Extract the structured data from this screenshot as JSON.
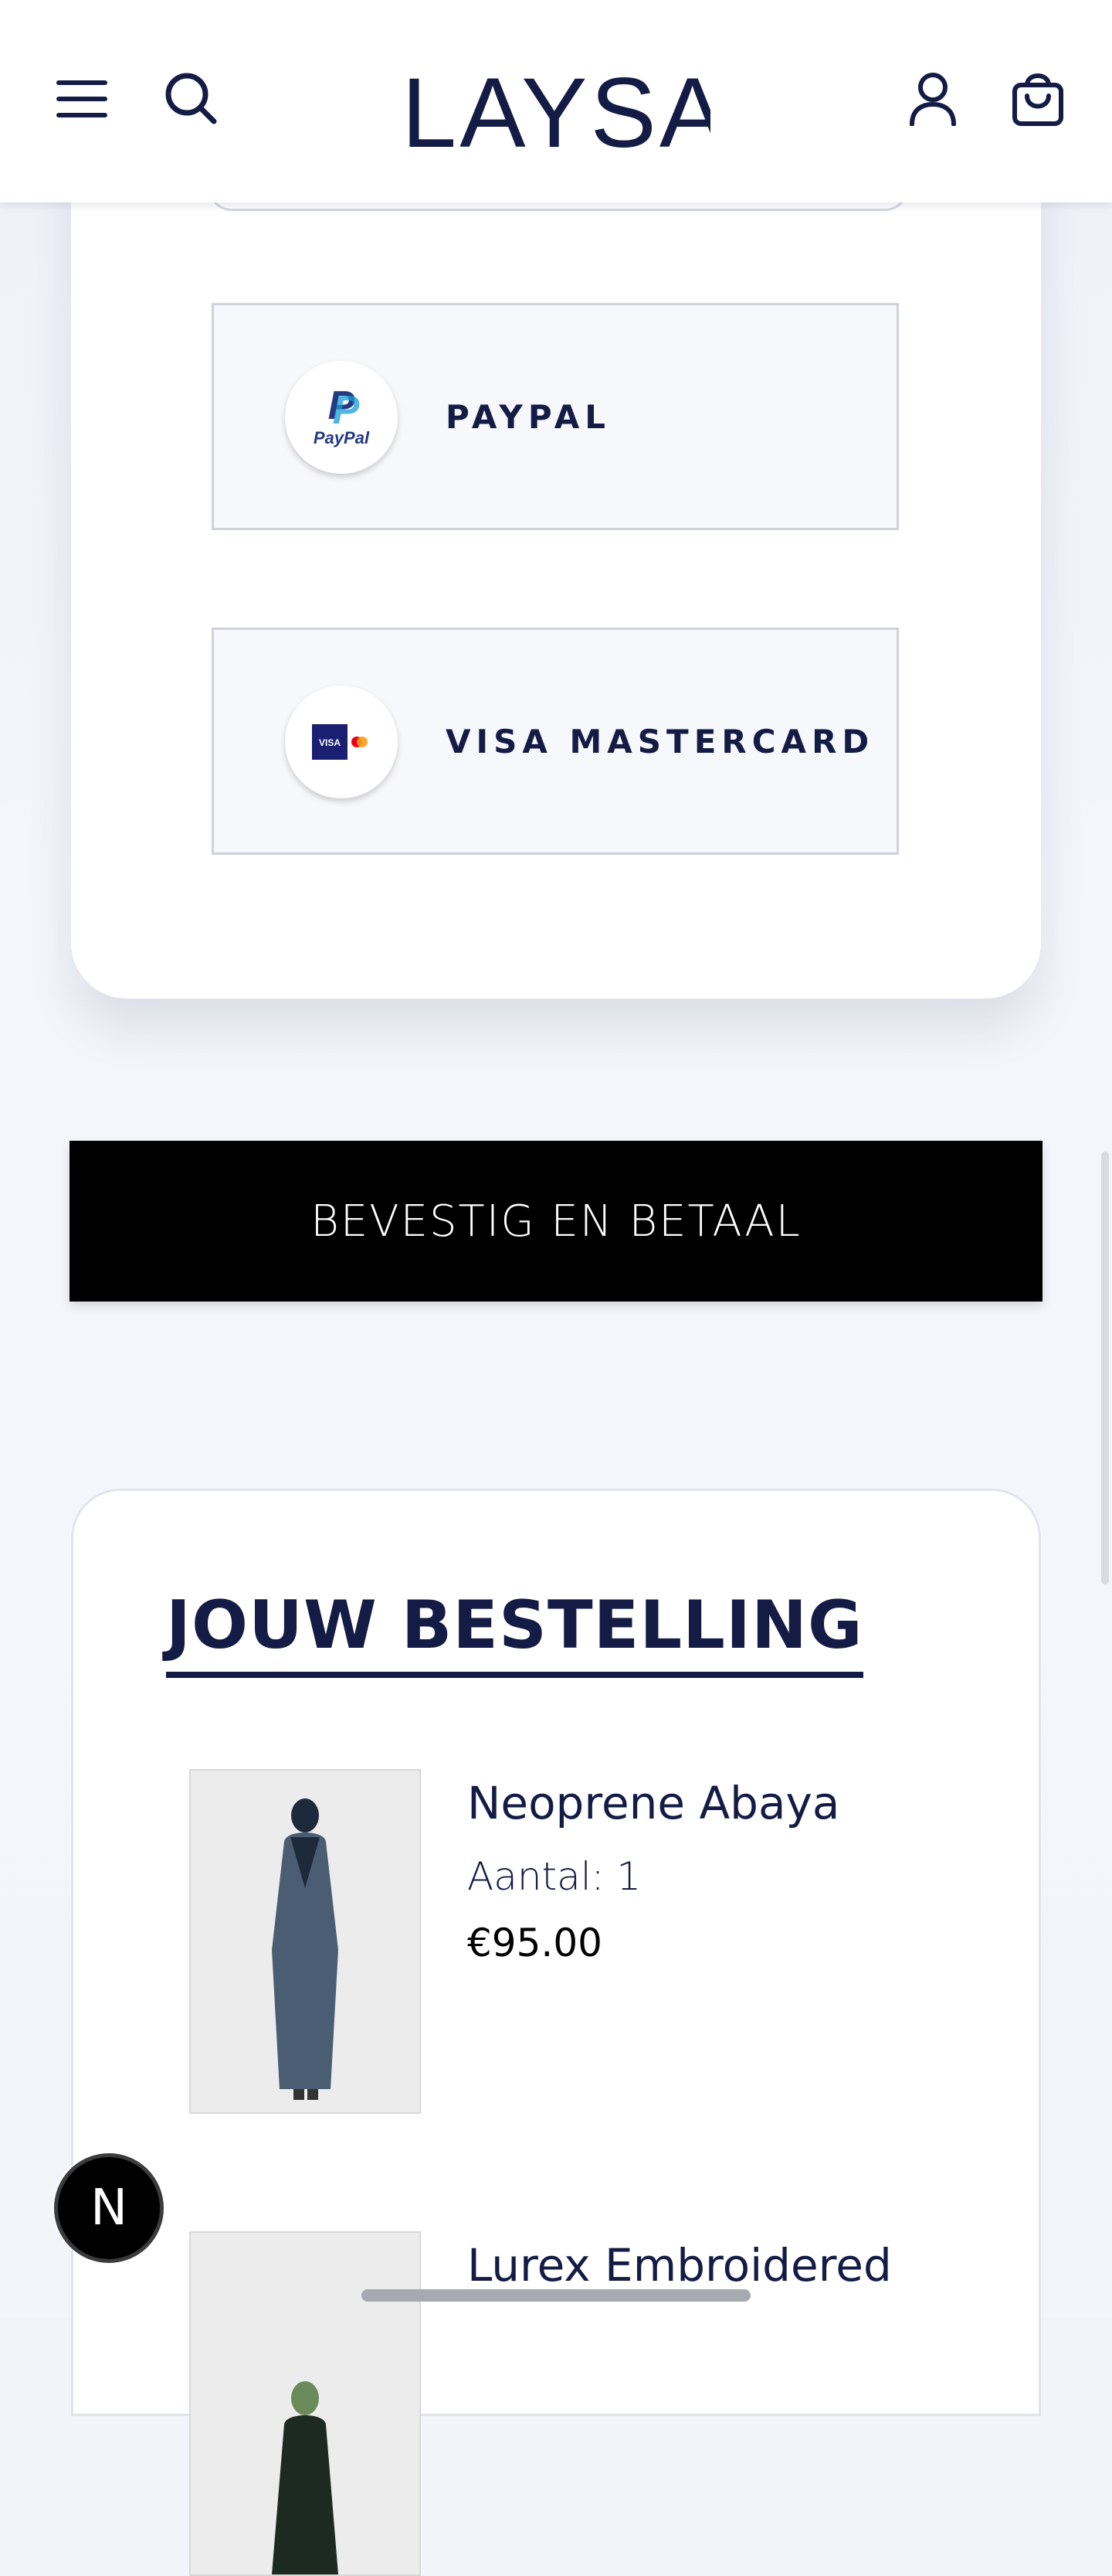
{
  "header": {
    "brand": "LAYSAH",
    "menu_icon": "hamburger-menu-icon",
    "search_icon": "search-icon",
    "account_icon": "user-icon",
    "cart_icon": "shopping-bag-icon"
  },
  "payment": {
    "options": [
      {
        "label": "PAYPAL",
        "icon": "paypal-logo",
        "logo_text": "PayPal"
      },
      {
        "label": "VISA MASTERCARD",
        "icon": "visa-mastercard-logo",
        "logo_text": "VISA"
      }
    ]
  },
  "confirm_button": {
    "label": "BEVESTIG EN BETAAL"
  },
  "order": {
    "title": "JOUW BESTELLING",
    "items": [
      {
        "name": "Neoprene Abaya",
        "quantity": "Aantal: 1",
        "price": "€95.00"
      },
      {
        "name": "Lurex Embroidered"
      }
    ]
  },
  "dev_badge": {
    "label": "N"
  },
  "colors": {
    "navy": "#141c45",
    "button_bg": "#000000",
    "page_bg": "#f2f4fa"
  }
}
